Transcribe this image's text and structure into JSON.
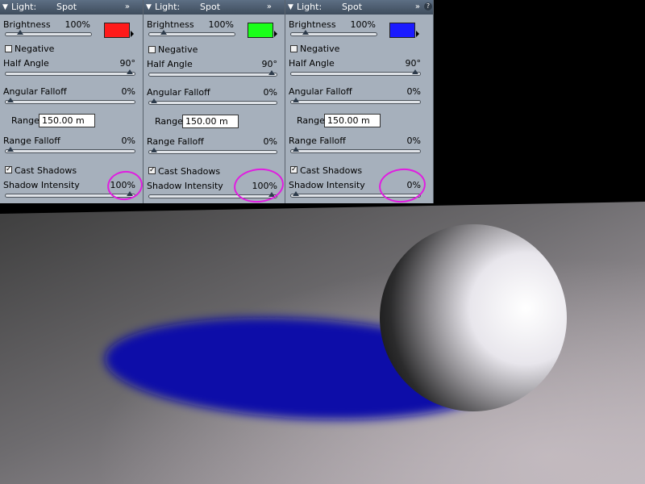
{
  "panels": [
    {
      "header": {
        "label": "Light:",
        "type": "Spot"
      },
      "brightness": {
        "label": "Brightness",
        "value": "100%",
        "fraction": 0.17
      },
      "color": "#ff1a1a",
      "negative": {
        "label": "Negative",
        "checked": false
      },
      "half_angle": {
        "label": "Half Angle",
        "value": "90°",
        "fraction": 1.0
      },
      "angular_falloff": {
        "label": "Angular Falloff",
        "value": "0%",
        "fraction": 0.0
      },
      "range": {
        "label": "Range",
        "value": "150.00 m"
      },
      "range_falloff": {
        "label": "Range Falloff",
        "value": "0%",
        "fraction": 0.0
      },
      "cast_shadows": {
        "label": "Cast Shadows",
        "checked": true
      },
      "shadow_intensity": {
        "label": "Shadow Intensity",
        "value": "100%",
        "fraction": 1.0
      }
    },
    {
      "header": {
        "label": "Light:",
        "type": "Spot"
      },
      "brightness": {
        "label": "Brightness",
        "value": "100%",
        "fraction": 0.17
      },
      "color": "#1aff1a",
      "negative": {
        "label": "Negative",
        "checked": false
      },
      "half_angle": {
        "label": "Half Angle",
        "value": "90°",
        "fraction": 1.0
      },
      "angular_falloff": {
        "label": "Angular Falloff",
        "value": "0%",
        "fraction": 0.0
      },
      "range": {
        "label": "Range",
        "value": "150.00 m"
      },
      "range_falloff": {
        "label": "Range Falloff",
        "value": "0%",
        "fraction": 0.0
      },
      "cast_shadows": {
        "label": "Cast Shadows",
        "checked": true
      },
      "shadow_intensity": {
        "label": "Shadow Intensity",
        "value": "100%",
        "fraction": 1.0
      }
    },
    {
      "header": {
        "label": "Light:",
        "type": "Spot"
      },
      "brightness": {
        "label": "Brightness",
        "value": "100%",
        "fraction": 0.17
      },
      "color": "#1a1aff",
      "negative": {
        "label": "Negative",
        "checked": false
      },
      "half_angle": {
        "label": "Half Angle",
        "value": "90°",
        "fraction": 1.0
      },
      "angular_falloff": {
        "label": "Angular Falloff",
        "value": "0%",
        "fraction": 0.0
      },
      "range": {
        "label": "Range",
        "value": "150.00 m"
      },
      "range_falloff": {
        "label": "Range Falloff",
        "value": "0%",
        "fraction": 0.0
      },
      "cast_shadows": {
        "label": "Cast Shadows",
        "checked": true
      },
      "shadow_intensity": {
        "label": "Shadow Intensity",
        "value": "0%",
        "fraction": 0.0
      }
    }
  ],
  "icons": {
    "collapse": "double-chevron-down-icon",
    "help": "help-icon",
    "menu": "triangle-down-icon"
  },
  "colors": {
    "panel_bg": "#a6b0bc",
    "header_bg": "#4a5a6c",
    "annotation": "#e01ce0",
    "shadow": "#0a0aa8"
  }
}
